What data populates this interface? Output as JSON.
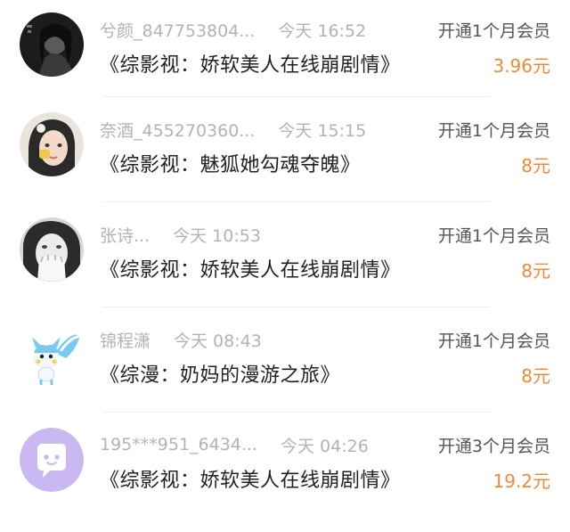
{
  "records": [
    {
      "avatar": "dark-portrait-avatar",
      "name": "兮颜_847753804...",
      "time": "今天 16:52",
      "title": "《综影视：娇软美人在线崩剧情》",
      "action": "开通1个月会员",
      "price": "3.96元"
    },
    {
      "avatar": "girl-portrait-avatar",
      "name": "奈酒_455270360...",
      "time": "今天 15:15",
      "title": "《综影视：魅狐她勾魂夺魄》",
      "action": "开通1个月会员",
      "price": "8元"
    },
    {
      "avatar": "covered-face-avatar",
      "name": "张诗...",
      "time": "今天 10:53",
      "title": "《综影视：娇软美人在线崩剧情》",
      "action": "开通1个月会员",
      "price": "8元"
    },
    {
      "avatar": "pachirisu-avatar",
      "name": "锦程潇",
      "time": "今天 08:43",
      "title": "《综漫：奶妈的漫游之旅》",
      "action": "开通1个月会员",
      "price": "8元"
    },
    {
      "avatar": "chat-bubble-avatar",
      "name": "195***951_6434...",
      "time": "今天 04:26",
      "title": "《综影视：娇软美人在线崩剧情》",
      "action": "开通3个月会员",
      "price": "19.2元"
    }
  ],
  "colors": {
    "price": "#f08a3a",
    "meta": "#b3b3b3",
    "title": "#222222",
    "action": "#555555",
    "bubble_bg": "#c9b8f2"
  }
}
